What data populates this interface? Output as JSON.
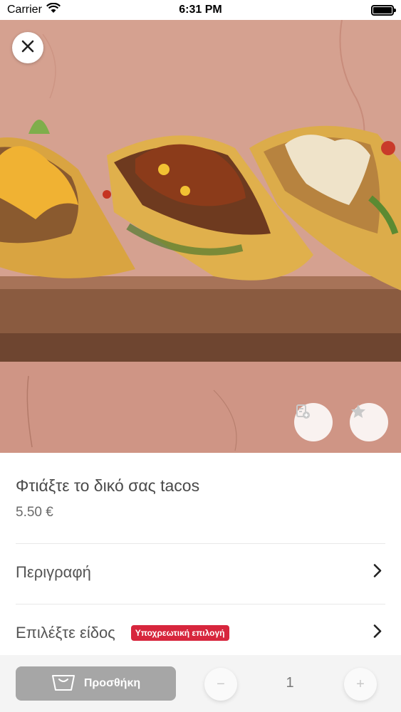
{
  "status_bar": {
    "carrier": "Carrier",
    "time": "6:31 PM",
    "icons": [
      "wifi-icon",
      "battery-icon"
    ]
  },
  "hero": {
    "icons": [
      "close-icon",
      "note-add-icon",
      "star-icon"
    ]
  },
  "product": {
    "title": "Φτιάξτε το δικό σας tacos",
    "price": "5.50 €"
  },
  "rows": {
    "description_label": "Περιγραφή",
    "select_type_label": "Επιλέξτε είδος",
    "required_badge": "Υποχρεωτική επιλογή"
  },
  "bottom_bar": {
    "add_label": "Προσθήκη",
    "minus_symbol": "−",
    "quantity": "1",
    "plus_symbol": "+"
  },
  "colors": {
    "accent_red": "#d7263d",
    "add_button_disabled": "#a6a6a6"
  }
}
